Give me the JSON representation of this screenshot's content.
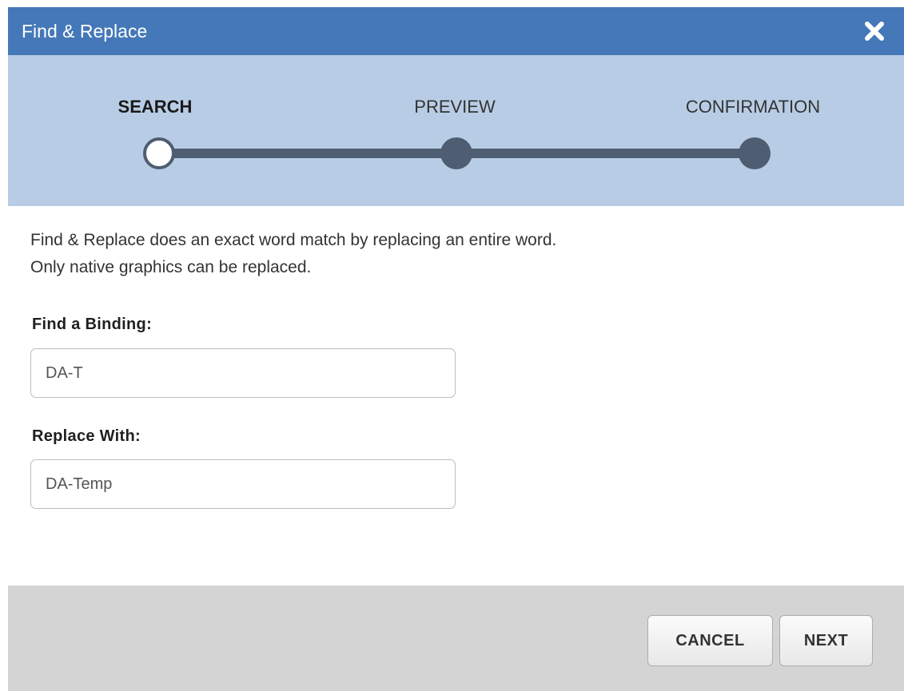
{
  "dialog": {
    "title": "Find & Replace",
    "close_icon": "close-icon"
  },
  "stepper": {
    "steps": [
      {
        "label": "SEARCH",
        "state": "current"
      },
      {
        "label": "PREVIEW",
        "state": "upcoming"
      },
      {
        "label": "CONFIRMATION",
        "state": "upcoming"
      }
    ],
    "current_step": 1
  },
  "content": {
    "description_line1": "Find & Replace does an exact word match by replacing an entire word.",
    "description_line2": "Only native graphics can be replaced.",
    "find": {
      "label": "Find a Binding:",
      "value": "DA-T"
    },
    "replace": {
      "label": "Replace With:",
      "value": "DA-Temp"
    }
  },
  "footer": {
    "cancel_label": "CANCEL",
    "next_label": "NEXT"
  },
  "colors": {
    "titlebar": "#4478b8",
    "stepper_bg": "#b8cde5",
    "stepper_track": "#4e5d71",
    "footer_bg": "#d4d4d4"
  }
}
